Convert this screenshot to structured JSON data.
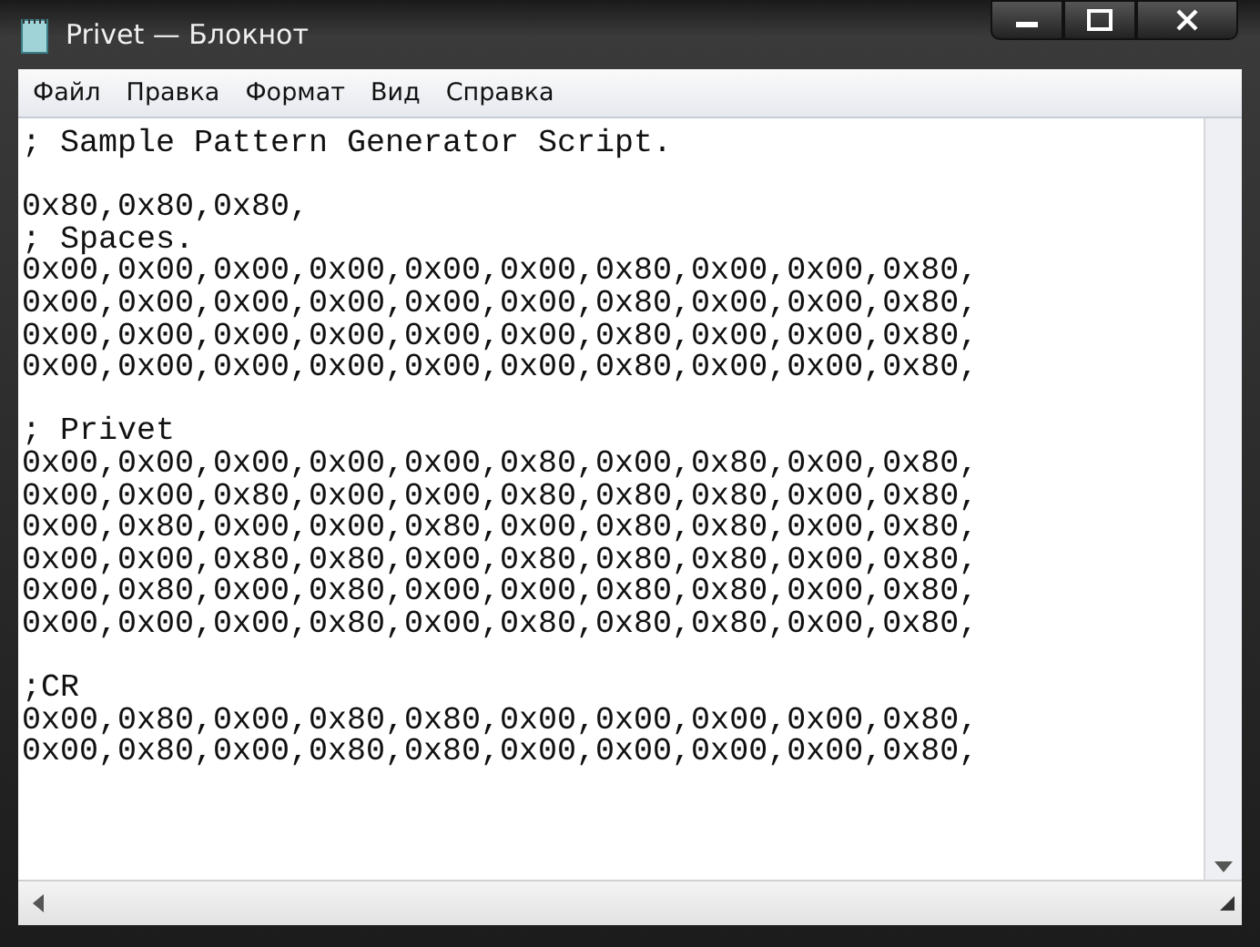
{
  "window": {
    "title": "Privet — Блокнот"
  },
  "menu": [
    "Файл",
    "Правка",
    "Формат",
    "Вид",
    "Справка"
  ],
  "text_blocks": [
    [
      "; Sample Pattern Generator Script."
    ],
    [
      "0x80,0x80,0x80,",
      "; Spaces.",
      "0x00,0x00,0x00,0x00,0x00,0x00,0x80,0x00,0x00,0x80,",
      "0x00,0x00,0x00,0x00,0x00,0x00,0x80,0x00,0x00,0x80,",
      "0x00,0x00,0x00,0x00,0x00,0x00,0x80,0x00,0x00,0x80,",
      "0x00,0x00,0x00,0x00,0x00,0x00,0x80,0x00,0x00,0x80,"
    ],
    [
      "; Privet",
      "0x00,0x00,0x00,0x00,0x00,0x80,0x00,0x80,0x00,0x80,",
      "0x00,0x00,0x80,0x00,0x00,0x80,0x80,0x80,0x00,0x80,",
      "0x00,0x80,0x00,0x00,0x80,0x00,0x80,0x80,0x00,0x80,",
      "0x00,0x00,0x80,0x80,0x00,0x80,0x80,0x80,0x00,0x80,",
      "0x00,0x80,0x00,0x80,0x00,0x00,0x80,0x80,0x00,0x80,",
      "0x00,0x00,0x00,0x80,0x00,0x80,0x80,0x80,0x00,0x80,"
    ],
    [
      ";CR",
      "0x00,0x80,0x00,0x80,0x80,0x00,0x00,0x00,0x00,0x80,",
      "0x00,0x80,0x00,0x80,0x80,0x00,0x00,0x00,0x00,0x80,"
    ]
  ]
}
